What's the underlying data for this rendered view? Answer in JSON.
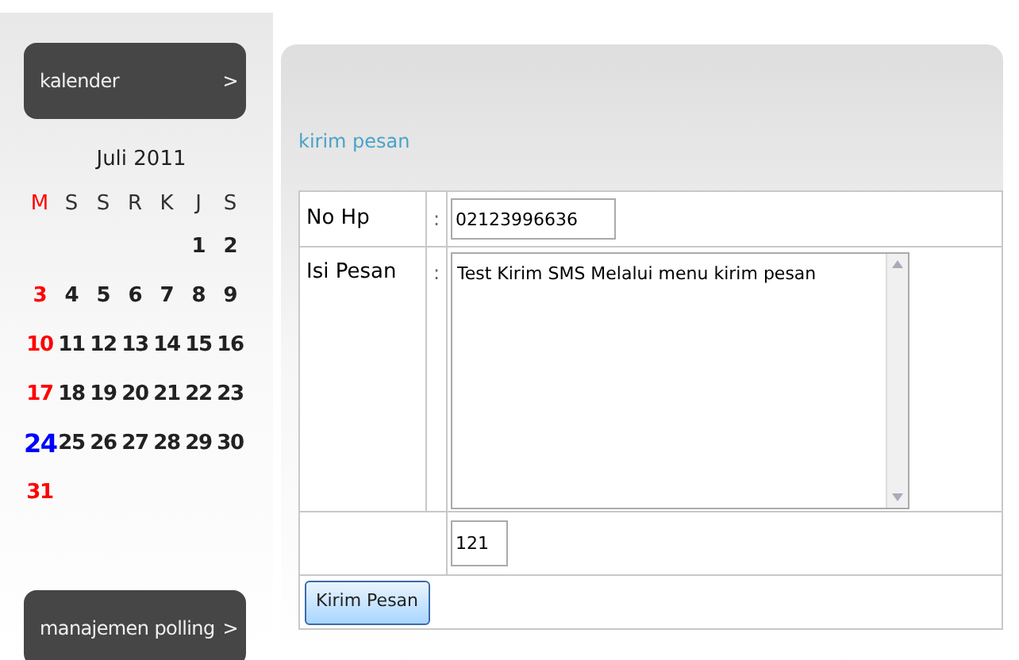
{
  "sidebar": {
    "menus": [
      {
        "label": "kalender",
        "arrow": ">"
      },
      {
        "label": "manajemen polling",
        "arrow": ">"
      }
    ],
    "calendar": {
      "month": "Juli 2011",
      "weekdays": [
        {
          "text": "M",
          "color": "#ff0000"
        },
        {
          "text": "S",
          "color": "#333333"
        },
        {
          "text": "S",
          "color": "#333333"
        },
        {
          "text": "R",
          "color": "#333333"
        },
        {
          "text": "K",
          "color": "#333333"
        },
        {
          "text": "J",
          "color": "#333333"
        },
        {
          "text": "S",
          "color": "#333333"
        }
      ],
      "weeks": [
        [
          {
            "text": "1",
            "color": "#222222"
          },
          {
            "text": "2",
            "color": "#222222"
          }
        ],
        [
          {
            "text": "3",
            "color": "#ff0000"
          },
          {
            "text": "4",
            "color": "#222222"
          },
          {
            "text": "5",
            "color": "#222222"
          },
          {
            "text": "6",
            "color": "#222222"
          },
          {
            "text": "7",
            "color": "#222222"
          },
          {
            "text": "8",
            "color": "#222222"
          },
          {
            "text": "9",
            "color": "#222222"
          }
        ],
        [
          {
            "text": "10",
            "color": "#ff0000"
          },
          {
            "text": "11",
            "color": "#222222"
          },
          {
            "text": "12",
            "color": "#222222"
          },
          {
            "text": "13",
            "color": "#222222"
          },
          {
            "text": "14",
            "color": "#222222"
          },
          {
            "text": "15",
            "color": "#222222"
          },
          {
            "text": "16",
            "color": "#222222"
          }
        ],
        [
          {
            "text": "17",
            "color": "#ff0000"
          },
          {
            "text": "18",
            "color": "#222222"
          },
          {
            "text": "19",
            "color": "#222222"
          },
          {
            "text": "20",
            "color": "#222222"
          },
          {
            "text": "21",
            "color": "#222222"
          },
          {
            "text": "22",
            "color": "#222222"
          },
          {
            "text": "23",
            "color": "#222222"
          }
        ],
        [
          {
            "text": "24",
            "color": "#0000ff"
          },
          {
            "text": "25",
            "color": "#222222"
          },
          {
            "text": "26",
            "color": "#222222"
          },
          {
            "text": "27",
            "color": "#222222"
          },
          {
            "text": "28",
            "color": "#222222"
          },
          {
            "text": "29",
            "color": "#222222"
          },
          {
            "text": "30",
            "color": "#222222"
          }
        ],
        [
          {
            "text": "31",
            "color": "#ff0000"
          }
        ]
      ]
    }
  },
  "main": {
    "title": "kirim pesan",
    "form": {
      "phone_label": "No Hp",
      "separator": ":",
      "phone_value": "02123996636",
      "message_label": "Isi Pesan",
      "message_separator": ":",
      "message_value": "Test Kirim SMS Melalui menu kirim pesan",
      "counter_value": "121",
      "submit": "Kirim Pesan"
    }
  }
}
